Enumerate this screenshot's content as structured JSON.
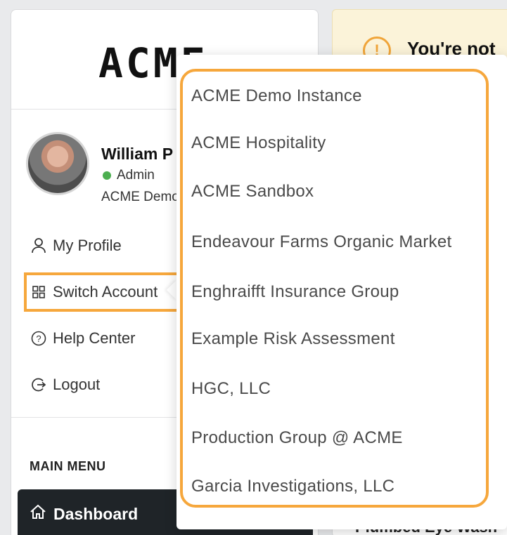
{
  "logo": {
    "text": "ACME"
  },
  "user": {
    "name": "William P",
    "role": "Admin",
    "account": "ACME Demo"
  },
  "profile_menu": {
    "my_profile": "My Profile",
    "switch_account": "Switch Account",
    "help_center": "Help Center",
    "logout": "Logout"
  },
  "main_menu": {
    "heading": "MAIN MENU",
    "dashboard": "Dashboard"
  },
  "alert": {
    "title": "You're not",
    "icon": "!"
  },
  "content": {
    "peek_text": "Plumbed Eye Wash"
  },
  "switch_account_dropdown": {
    "options": [
      "ACME Demo Instance",
      "ACME Hospitality",
      "ACME Sandbox",
      "Endeavour Farms Organic Market",
      "Enghraifft Insurance Group",
      "Example Risk Assessment",
      "HGC, LLC",
      "Production Group @ ACME",
      "Garcia Investigations, LLC"
    ]
  },
  "colors": {
    "highlight": "#f6a73c",
    "status_online": "#4caf50",
    "dashboard_bg": "#1f2428",
    "alert_bg": "#fbf3d9"
  }
}
